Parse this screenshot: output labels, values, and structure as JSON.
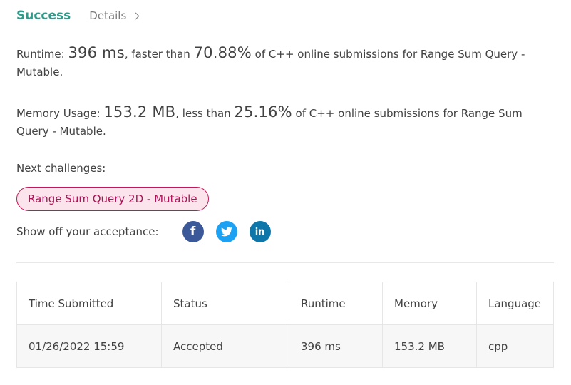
{
  "tabs": {
    "success": "Success",
    "details": "Details"
  },
  "runtime": {
    "label": "Runtime:",
    "value": "396 ms",
    "mid": ", faster than",
    "percent": "70.88%",
    "tail": "of C++ online submissions for Range Sum Query - Mutable."
  },
  "memory": {
    "label": "Memory Usage:",
    "value": "153.2 MB",
    "mid": ", less than",
    "percent": "25.16%",
    "tail": "of C++ online submissions for Range Sum Query - Mutable."
  },
  "next": {
    "label": "Next challenges:",
    "challenge": "Range Sum Query 2D - Mutable"
  },
  "share": {
    "label": "Show off your acceptance:",
    "facebook_glyph": "f",
    "twitter_glyph": "t",
    "linkedin_glyph": "in"
  },
  "table": {
    "headers": [
      "Time Submitted",
      "Status",
      "Runtime",
      "Memory",
      "Language"
    ],
    "rows": [
      [
        "01/26/2022 15:59",
        "Accepted",
        "396 ms",
        "153.2 MB",
        "cpp"
      ]
    ]
  },
  "colors": {
    "accent": "#2e9b8a",
    "challenge_bg": "#fce4ec",
    "challenge_text": "#ad1457",
    "facebook": "#3b5998",
    "twitter": "#1da1f2",
    "linkedin": "#0e76a8"
  }
}
